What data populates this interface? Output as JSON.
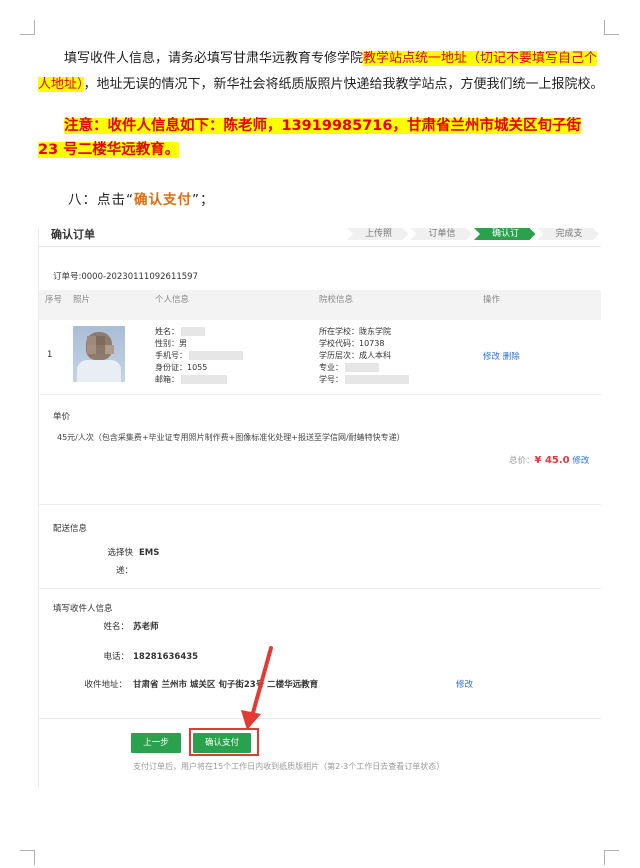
{
  "doc": {
    "para1_a": "填写收件人信息，请务必填写甘肃华远教育专修学院",
    "para1_hl": "教学站点统一地址（切记不要填写自己个人地址）",
    "para1_b": "，地址无误的情况下，新华社会将纸质版照片快递给我教学站点，方便我们统一上报院校。",
    "para2": "注意：收件人信息如下：陈老师，13919985716，甘肃省兰州市城关区旬子街 23 号二楼华远教育。",
    "step8_prefix": "八：点击“",
    "step8_action": "确认支付",
    "step8_suffix": "”；"
  },
  "screenshot": {
    "title": "确认订单",
    "steps": [
      "上传照片",
      "订单信息",
      "确认订单",
      "完成支付"
    ],
    "order_no": "订单号:0000-20230111092611597",
    "table_headers": {
      "idx": "序号",
      "photo": "照片",
      "personal": "个人信息",
      "school": "院校信息",
      "ops": "操作"
    },
    "row": {
      "idx": "1",
      "name_label": "姓名：",
      "gender_label": "性别：",
      "gender": "男",
      "phone_label": "手机号：",
      "id_label": "身份证：",
      "id_tail": "1055",
      "email_label": "邮箱：",
      "school_label": "所在学校：",
      "school": "陇东学院",
      "code_label": "学校代码：",
      "code": "10738",
      "level_label": "学历层次：",
      "level": "成人本科",
      "major_label": "专业：",
      "sno_label": "学号：",
      "edit": "修改",
      "delete": "删除"
    },
    "price": {
      "title": "单价",
      "desc": "45元/人次（包含采集费+毕业证专用照片制作费+图像标准化处理+报送至学信网/耐蝽特快专递）",
      "total_label": "总价：",
      "total_amount": "¥ 45.0",
      "modify": "修改"
    },
    "shipping": {
      "title": "配送信息",
      "method_label": "选择快递：",
      "method": "EMS"
    },
    "recipient": {
      "title": "填写收件人信息",
      "name_label": "姓名：",
      "name": "苏老师",
      "phone_label": "电话：",
      "phone": "18281636435",
      "addr_label": "收件地址：",
      "addr": "甘肃省 兰州市 城关区 旬子街23号 二楼华远教育",
      "modify": "修改"
    },
    "buttons": {
      "prev": "上一步",
      "pay": "确认支付"
    },
    "tip": "支付订单后，用户将在15个工作日内收到纸质版相片（第2-3个工作日去查看订单状态）"
  },
  "colors": {
    "highlight": "#ffff00",
    "note_red": "#e60000",
    "orange": "#e36c09",
    "green": "#2aa14c",
    "link_blue": "#2a6fd6",
    "price_red": "#e4393c",
    "arrow_red": "#e53935"
  }
}
